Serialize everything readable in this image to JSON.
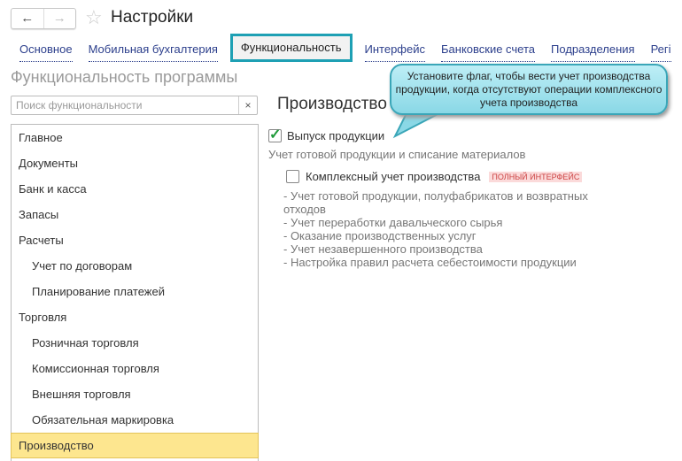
{
  "window": {
    "title": "Настройки",
    "back_icon": "←",
    "forward_icon": "→",
    "star_icon": "☆"
  },
  "tabs": [
    "Основное",
    "Мобильная бухгалтерия",
    "Функциональность",
    "Интерфейс",
    "Банковские счета",
    "Подразделения",
    "Регі"
  ],
  "heading": "Функциональность программы",
  "search": {
    "placeholder": "Поиск функциональности",
    "clear": "×"
  },
  "sections": [
    {
      "label": "Главное",
      "sub": false
    },
    {
      "label": "Документы",
      "sub": false
    },
    {
      "label": "Банк и касса",
      "sub": false
    },
    {
      "label": "Запасы",
      "sub": false
    },
    {
      "label": "Расчеты",
      "sub": false
    },
    {
      "label": "Учет по договорам",
      "sub": true
    },
    {
      "label": "Планирование платежей",
      "sub": true
    },
    {
      "label": "Торговля",
      "sub": false
    },
    {
      "label": "Розничная торговля",
      "sub": true
    },
    {
      "label": "Комиссионная торговля",
      "sub": true
    },
    {
      "label": "Внешняя торговля",
      "sub": true
    },
    {
      "label": "Обязательная маркировка",
      "sub": true
    },
    {
      "label": "Производство",
      "sub": false,
      "selected": true
    }
  ],
  "main": {
    "title": "Производство",
    "option1": {
      "label": "Выпуск продукции",
      "checked": true,
      "description": "Учет готовой продукции и списание материалов"
    },
    "option2": {
      "label": "Комплексный учет производства",
      "checked": false,
      "badge": "ПОЛНЫЙ ИНТЕРФЕЙС",
      "lines": [
        "- Учет готовой продукции, полуфабрикатов и возвратных отходов",
        "- Учет переработки давальческого сырья",
        "- Оказание производственных услуг",
        "- Учет незавершенного производства",
        "- Настройка правил расчета себестоимости продукции"
      ]
    }
  },
  "callout": {
    "text": "Установите флаг, чтобы вести учет производства продукции, когда отсутствуют операции комплексного учета производства"
  }
}
